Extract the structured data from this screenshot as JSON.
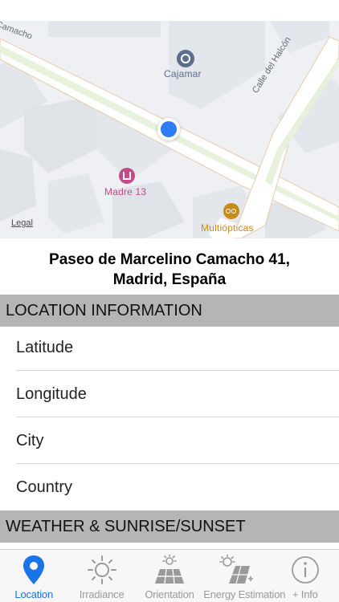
{
  "map": {
    "pois": [
      {
        "name": "Cajamar",
        "icon": "bank-icon",
        "color": "#5b6f8c"
      },
      {
        "name": "Madre 13",
        "icon": "shopping-icon",
        "color": "#c24a87"
      },
      {
        "name": "Multiópticas",
        "icon": "glasses-icon",
        "color": "#c98a1a"
      }
    ],
    "streets": [
      "Camacho",
      "Calle del Halcón"
    ],
    "legal": "Legal",
    "location_dot_color": "#2f7cf6"
  },
  "address": {
    "line1": "Paseo de Marcelino Camacho 41,",
    "line2": "Madrid, España"
  },
  "location_section": {
    "title": "LOCATION INFORMATION",
    "rows": [
      "Latitude",
      "Longitude",
      "City",
      "Country"
    ]
  },
  "weather_section": {
    "title": "WEATHER & SUNRISE/SUNSET"
  },
  "tabbar": {
    "active_color": "#1a73e8",
    "inactive_color": "#9a9a9a",
    "tabs": [
      {
        "label": "Location",
        "icon": "location-pin-icon",
        "active": true
      },
      {
        "label": "Irradiance",
        "icon": "sun-icon",
        "active": false
      },
      {
        "label": "Orientation",
        "icon": "solar-panel-sun-icon",
        "active": false
      },
      {
        "label": "Energy Estimation",
        "icon": "solar-energy-plug-icon",
        "active": false
      },
      {
        "label": "+ Info",
        "icon": "info-icon",
        "active": false
      }
    ]
  }
}
